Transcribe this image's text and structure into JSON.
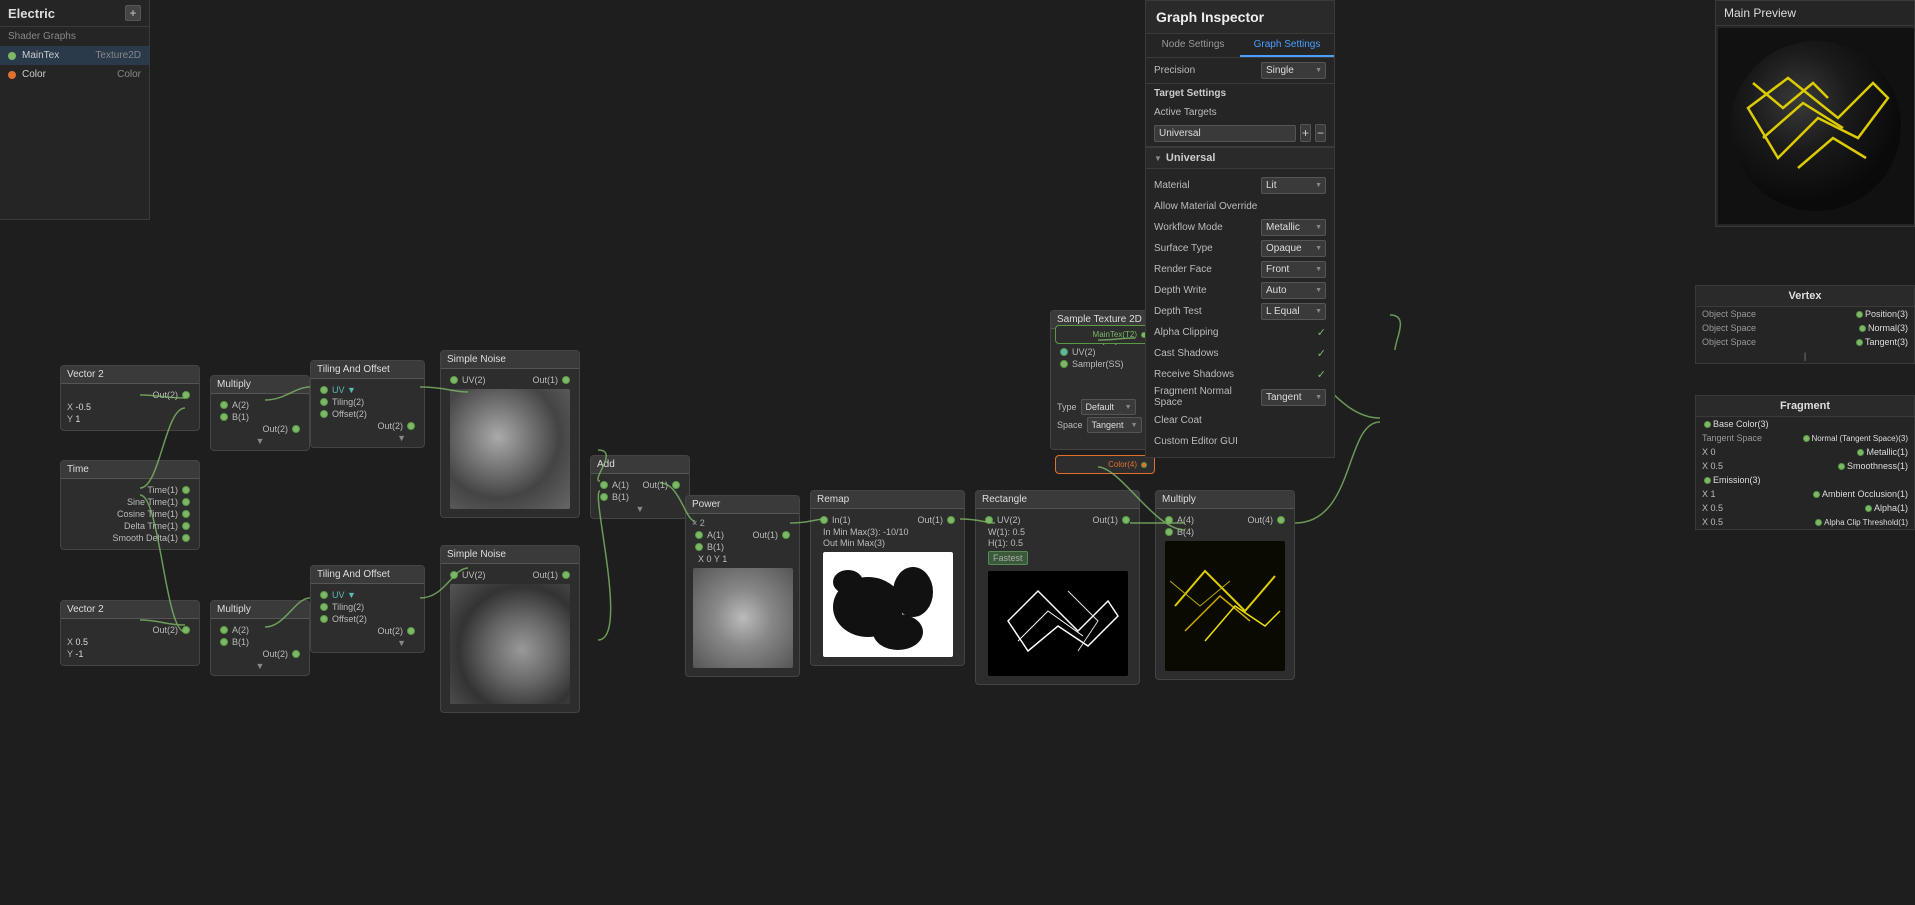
{
  "sidebar": {
    "title": "Electric",
    "subtitle": "Shader Graphs",
    "add_button": "+",
    "properties": [
      {
        "name": "MainTex",
        "type": "Texture2D",
        "color": "green"
      },
      {
        "name": "Color",
        "type": "Color",
        "color": "orange"
      }
    ]
  },
  "inspector": {
    "title": "Graph Inspector",
    "tabs": [
      {
        "label": "Node Settings",
        "active": false
      },
      {
        "label": "Graph Settings",
        "active": true
      }
    ],
    "precision_label": "Precision",
    "precision_value": "Single",
    "target_settings_label": "Target Settings",
    "active_targets_label": "Active Targets",
    "universal_value": "Universal",
    "add_btn": "+",
    "remove_btn": "−",
    "section_universal": "Universal",
    "material_label": "Material",
    "material_value": "Lit",
    "allow_override_label": "Allow Material Override",
    "workflow_mode_label": "Workflow Mode",
    "workflow_mode_value": "Metallic",
    "surface_type_label": "Surface Type",
    "surface_type_value": "Opaque",
    "render_face_label": "Render Face",
    "render_face_value": "Front",
    "depth_write_label": "Depth Write",
    "depth_write_value": "Auto",
    "depth_test_label": "Depth Test",
    "depth_test_value": "L Equal",
    "alpha_clipping_label": "Alpha Clipping",
    "alpha_clipping_check": "✓",
    "cast_shadows_label": "Cast Shadows",
    "cast_shadows_check": "✓",
    "receive_shadows_label": "Receive Shadows",
    "receive_shadows_check": "✓",
    "fragment_normal_label": "Fragment Normal Space",
    "fragment_normal_value": "Tangent",
    "clear_coat_label": "Clear Coat",
    "custom_editor_label": "Custom Editor GUI"
  },
  "main_preview": {
    "title": "Main Preview"
  },
  "nodes": {
    "vector2_1": {
      "title": "Vector 2",
      "x_val": "-0.5",
      "y_val": "1"
    },
    "vector2_2": {
      "title": "Vector 2",
      "x_val": "0.5",
      "y_val": "-1"
    },
    "time": {
      "title": "Time"
    },
    "multiply_1": {
      "title": "Multiply"
    },
    "multiply_2": {
      "title": "Multiply"
    },
    "tiling_offset_1": {
      "title": "Tiling And Offset"
    },
    "tiling_offset_2": {
      "title": "Tiling And Offset"
    },
    "simple_noise_1": {
      "title": "Simple Noise"
    },
    "simple_noise_2": {
      "title": "Simple Noise"
    },
    "add": {
      "title": "Add"
    },
    "power": {
      "title": "Power",
      "x_val": "0",
      "y_val": "1"
    },
    "remap": {
      "title": "Remap",
      "in_min": "-10",
      "in_max": "10"
    },
    "rectangle": {
      "title": "Rectangle",
      "x_val": "0.5",
      "y_val": "0.5"
    },
    "multiply_3": {
      "title": "Multiply"
    },
    "sample_tex2d": {
      "title": "Sample Texture 2D"
    },
    "vertex": {
      "title": "Vertex",
      "rows": [
        {
          "label": "Object Space",
          "port": "◉",
          "value": "Position(3)"
        },
        {
          "label": "Object Space",
          "port": "◉",
          "value": "Normal(3)"
        },
        {
          "label": "Object Space",
          "port": "◉",
          "value": "Tangent(3)"
        }
      ]
    },
    "fragment": {
      "title": "Fragment",
      "rows": [
        {
          "label": "Base Color(3)",
          "port": "◉"
        },
        {
          "label": "Normal (Tangent Space)(3)",
          "port": "◉"
        },
        {
          "label": "Metallic(1)",
          "x_val": "0"
        },
        {
          "label": "Smoothness(1)",
          "x_val": "0.5"
        },
        {
          "label": "Emission(3)",
          "port": "◉"
        },
        {
          "label": "Ambient Occlusion(1)",
          "x_val": "1"
        },
        {
          "label": "Alpha(1)",
          "x_val": "0.5"
        },
        {
          "label": "Alpha Clip Threshold(1)",
          "x_val": "0.5"
        }
      ]
    }
  }
}
